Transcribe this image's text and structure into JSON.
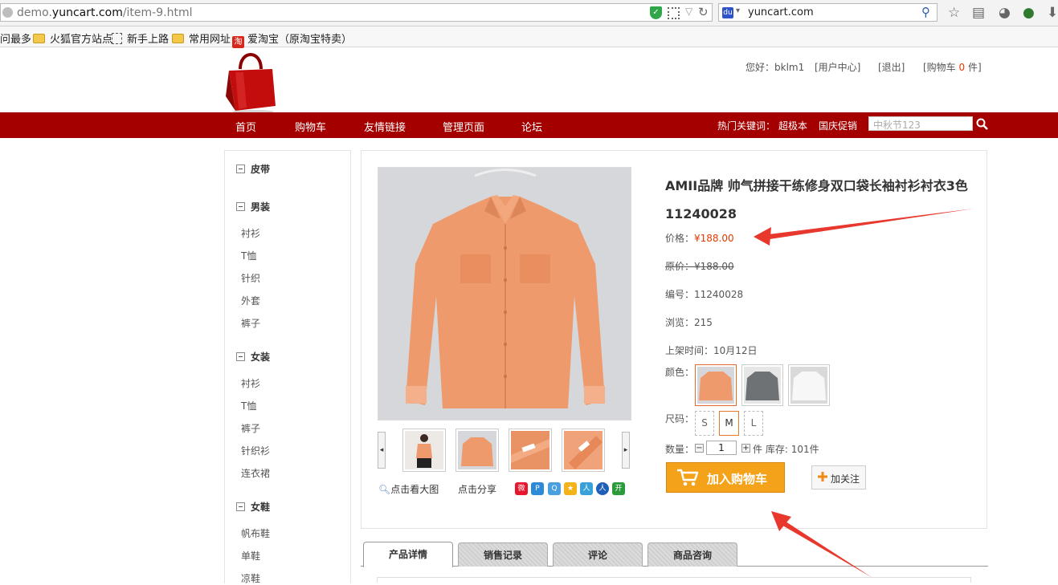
{
  "browser": {
    "url_prefix": "demo.",
    "url_domain": "yuncart.com",
    "url_path": "/item-9.html",
    "search_value": "yuncart.com",
    "bookmarks": [
      "问最多",
      "火狐官方站点",
      "新手上路",
      "常用网址",
      "爱淘宝（原淘宝特卖）"
    ]
  },
  "header": {
    "greeting": "您好：bklm1",
    "user_center": "[用户中心]",
    "logout": "[退出]",
    "cart_prefix": "[购物车",
    "cart_count": "0",
    "cart_suffix": "件]"
  },
  "nav": {
    "items": [
      "首页",
      "购物车",
      "友情链接",
      "管理页面",
      "论坛"
    ],
    "hot_label": "热门关键词：",
    "hot_keywords": [
      "超极本",
      "国庆促销"
    ],
    "search_placeholder": "中秋节123"
  },
  "sidebar": {
    "categories": [
      {
        "title": "皮带",
        "items": []
      },
      {
        "title": "男装",
        "items": [
          "衬衫",
          "T恤",
          "针织",
          "外套",
          "裤子"
        ]
      },
      {
        "title": "女装",
        "items": [
          "衬衫",
          "T恤",
          "裤子",
          "针织衫",
          "连衣裙"
        ]
      },
      {
        "title": "女鞋",
        "items": [
          "帆布鞋",
          "单鞋",
          "凉鞋"
        ]
      }
    ]
  },
  "product": {
    "title": "AMII品牌 帅气拼接干练修身双口袋长袖衬衫衬衣3色11240028",
    "price_label": "价格：",
    "price": "¥188.00",
    "orig_label": "原价：",
    "orig_price": "¥188.00",
    "sku_label": "编号：",
    "sku": "11240028",
    "views_label": "浏览：",
    "views": "215",
    "date_label": "上架时间：",
    "date": "10月12日",
    "color_label": "颜色：",
    "colors": [
      "橙色",
      "灰色",
      "白色"
    ],
    "size_label": "尺码：",
    "sizes": [
      "S",
      "M",
      "L"
    ],
    "selected_size": "M",
    "qty_label": "数量：",
    "qty": "1",
    "qty_unit": "件",
    "stock_label": "库存:",
    "stock": "101件",
    "add_cart": "加入购物车",
    "follow": "加关注",
    "view_large": "点击看大图",
    "share": "点击分享"
  },
  "tabs": [
    "产品详情",
    "销售记录",
    "评论",
    "商品咨询"
  ],
  "colors": {
    "brand_red": "#a40000",
    "price_red": "#e23a00",
    "cart_orange": "#f4a21a",
    "annotation_red": "#e8372c"
  }
}
